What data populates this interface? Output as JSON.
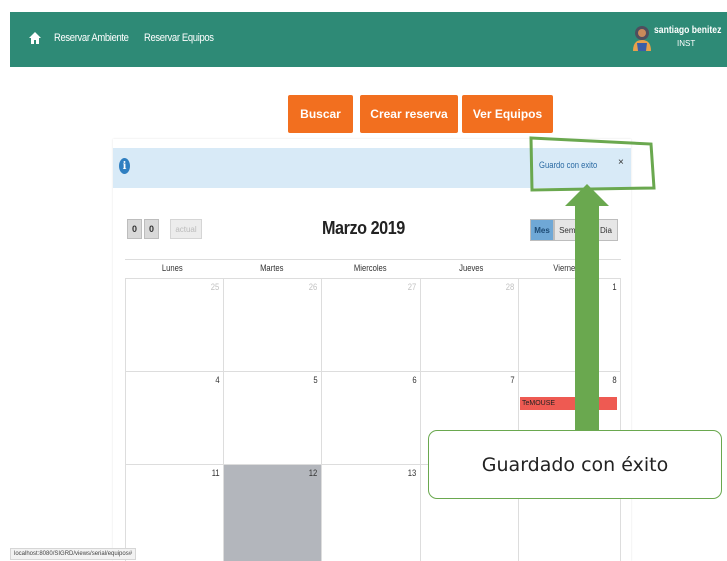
{
  "navbar": {
    "links": [
      "Reservar Ambiente",
      "Reservar Equipos"
    ],
    "user_name": "santiago benitez",
    "user_role": "INST",
    "color": "#2e8a76"
  },
  "actions": {
    "buscar": "Buscar",
    "crear_reserva": "Crear reserva",
    "ver_equipos": "Ver Equipos",
    "color": "#f26f1f"
  },
  "alert": {
    "icon": "info-icon",
    "message": "Guardo con exito",
    "close": "×"
  },
  "calendar": {
    "prev": "0",
    "next": "0",
    "today": "actual",
    "title": "Marzo 2019",
    "views": [
      "Mes",
      "Semana",
      "Dia"
    ],
    "active_view": "Mes",
    "day_headers": [
      "Lunes",
      "Martes",
      "Miercoles",
      "Jueves",
      "Viernes"
    ],
    "weeks": [
      [
        "25",
        "26",
        "27",
        "28",
        "1"
      ],
      [
        "4",
        "5",
        "6",
        "7",
        "8"
      ],
      [
        "11",
        "12",
        "13",
        "",
        ""
      ]
    ],
    "event": {
      "label": "TeMOUSE",
      "day": "8",
      "color": "#ee5a52"
    }
  },
  "status_url": "localhost:8080/SIGRD/views/serial/equipos#",
  "annotation": {
    "text": "Guardado con éxito",
    "color": "#6aa84f"
  }
}
